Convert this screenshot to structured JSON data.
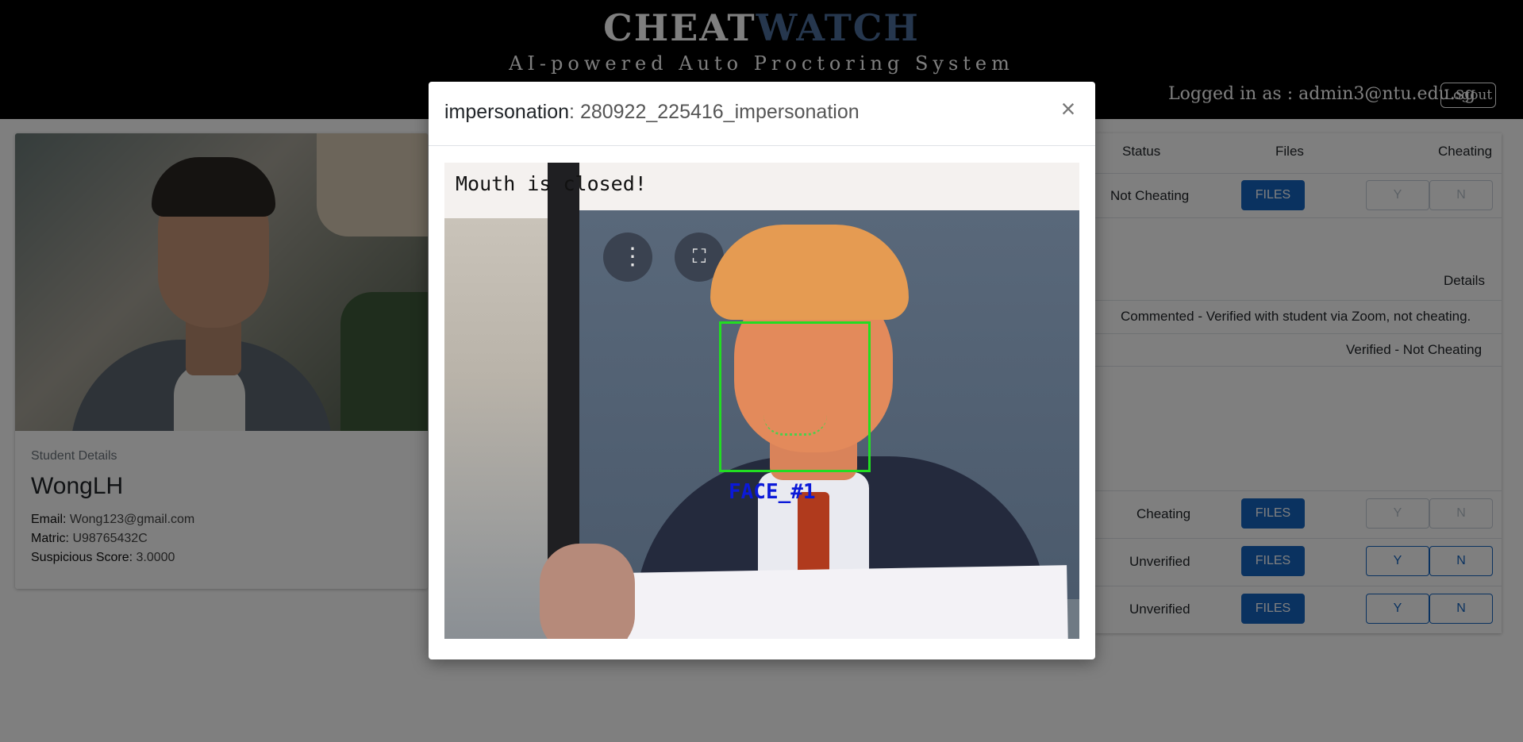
{
  "header": {
    "brand_part1": "CHEAT",
    "brand_part2": "WATCH",
    "tagline": "AI-powered Auto Proctoring System",
    "logged_in_text": "Logged in as : admin3@ntu.edu.sg",
    "logout_label": "Logout"
  },
  "student": {
    "section_label": "Student Details",
    "name": "WongLH",
    "email_label": "Email:",
    "email": "Wong123@gmail.com",
    "matric_label": "Matric:",
    "matric": "U98765432C",
    "score_label": "Suspicious Score:",
    "score": "3.0000"
  },
  "table": {
    "col_status": "Status",
    "col_files": "Files",
    "col_cheating": "Cheating",
    "files_label": "FILES",
    "yes_label": "Y",
    "no_label": "N",
    "rows": [
      {
        "status": "Not Cheating"
      },
      {
        "status": "Cheating"
      },
      {
        "status": "Unverified"
      },
      {
        "status": "Unverified"
      }
    ],
    "details_header": "Details",
    "details": [
      "Commented - Verified with student via Zoom, not cheating.",
      "Verified - Not Cheating"
    ]
  },
  "modal": {
    "title_type": "impersonation",
    "title_separator": ": ",
    "title_id": "280922_225416_impersonation",
    "close_symbol": "×",
    "cam_text": "Mouth is closed!",
    "face_label": "FACE_#1"
  },
  "colors": {
    "brand_accent": "#4d6f9c",
    "primary_button": "#1565c0",
    "face_box": "#22dd22",
    "face_label": "#0b19d8"
  },
  "icons": {
    "close": "close-icon",
    "cam_menu": "more-vertical-icon",
    "cam_screenshot": "screenshot-icon"
  }
}
